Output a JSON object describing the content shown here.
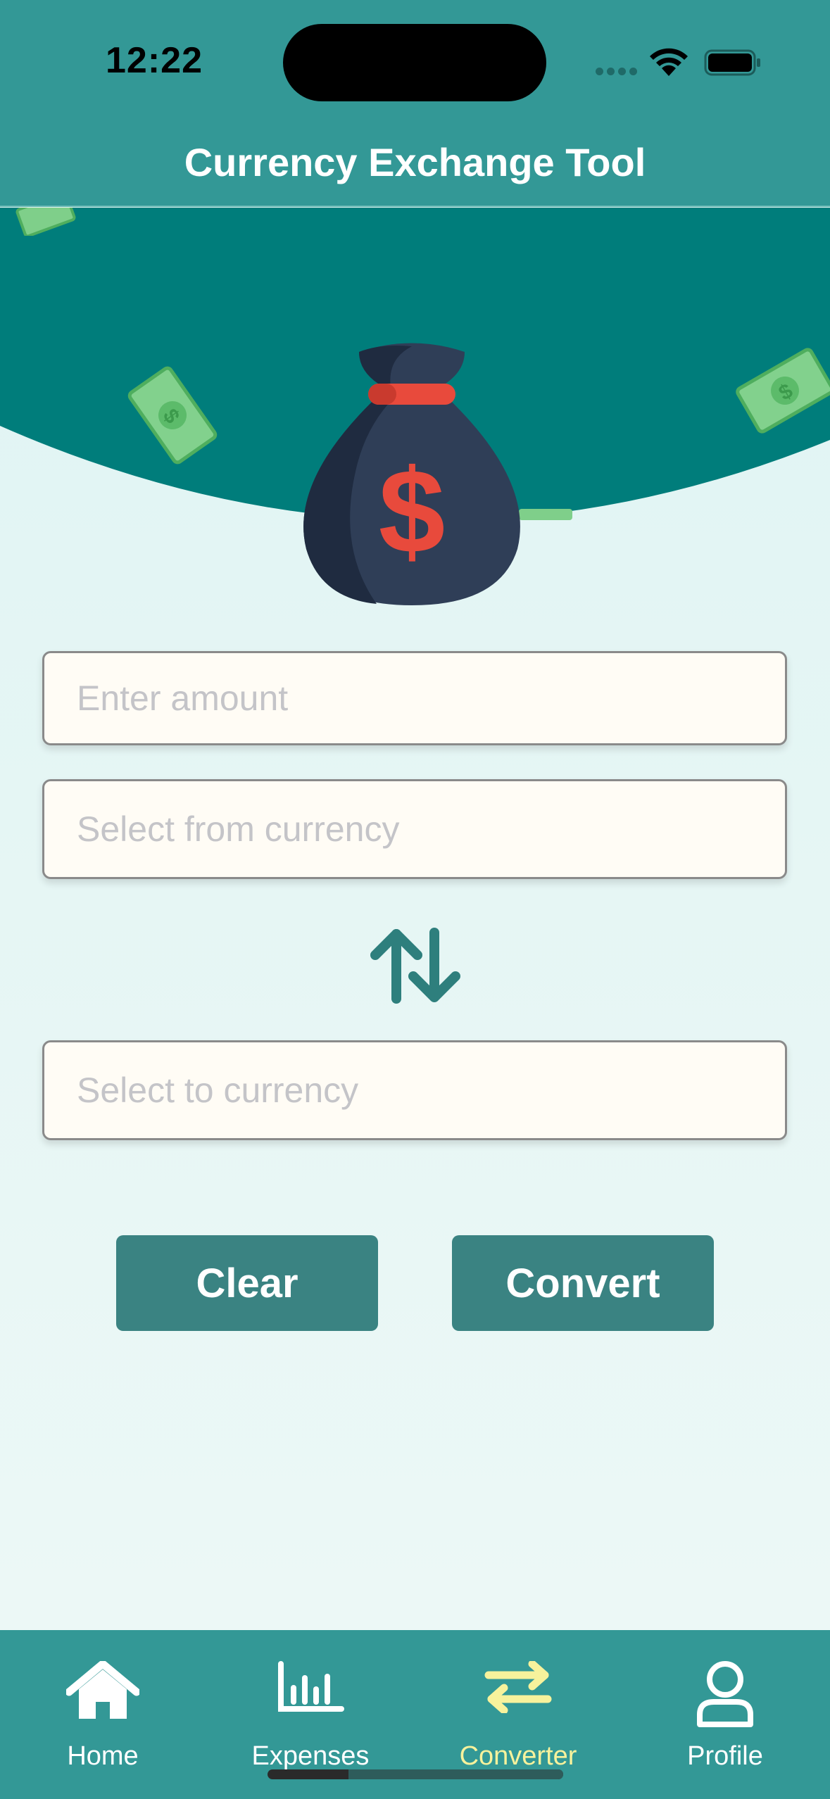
{
  "status": {
    "time": "12:22"
  },
  "header": {
    "title": "Currency Exchange Tool"
  },
  "form": {
    "amount": {
      "placeholder": "Enter amount",
      "value": ""
    },
    "from_currency": {
      "placeholder": "Select from currency",
      "value": ""
    },
    "to_currency": {
      "placeholder": "Select to currency",
      "value": ""
    },
    "swap_icon": "swap-vertical-arrows-icon"
  },
  "actions": {
    "clear_label": "Clear",
    "convert_label": "Convert"
  },
  "tabs": [
    {
      "label": "Home",
      "icon": "home-icon",
      "active": false
    },
    {
      "label": "Expenses",
      "icon": "bar-chart-icon",
      "active": false
    },
    {
      "label": "Converter",
      "icon": "swap-horizontal-icon",
      "active": true
    },
    {
      "label": "Profile",
      "icon": "person-icon",
      "active": false
    }
  ],
  "colors": {
    "header": "#339896",
    "hero": "#007d7b",
    "button": "#3a8382",
    "active_tab": "#f7f29c",
    "swap_icon": "#2e7f7d",
    "bag": "#2f3e57",
    "bag_accent": "#e84a3c"
  }
}
